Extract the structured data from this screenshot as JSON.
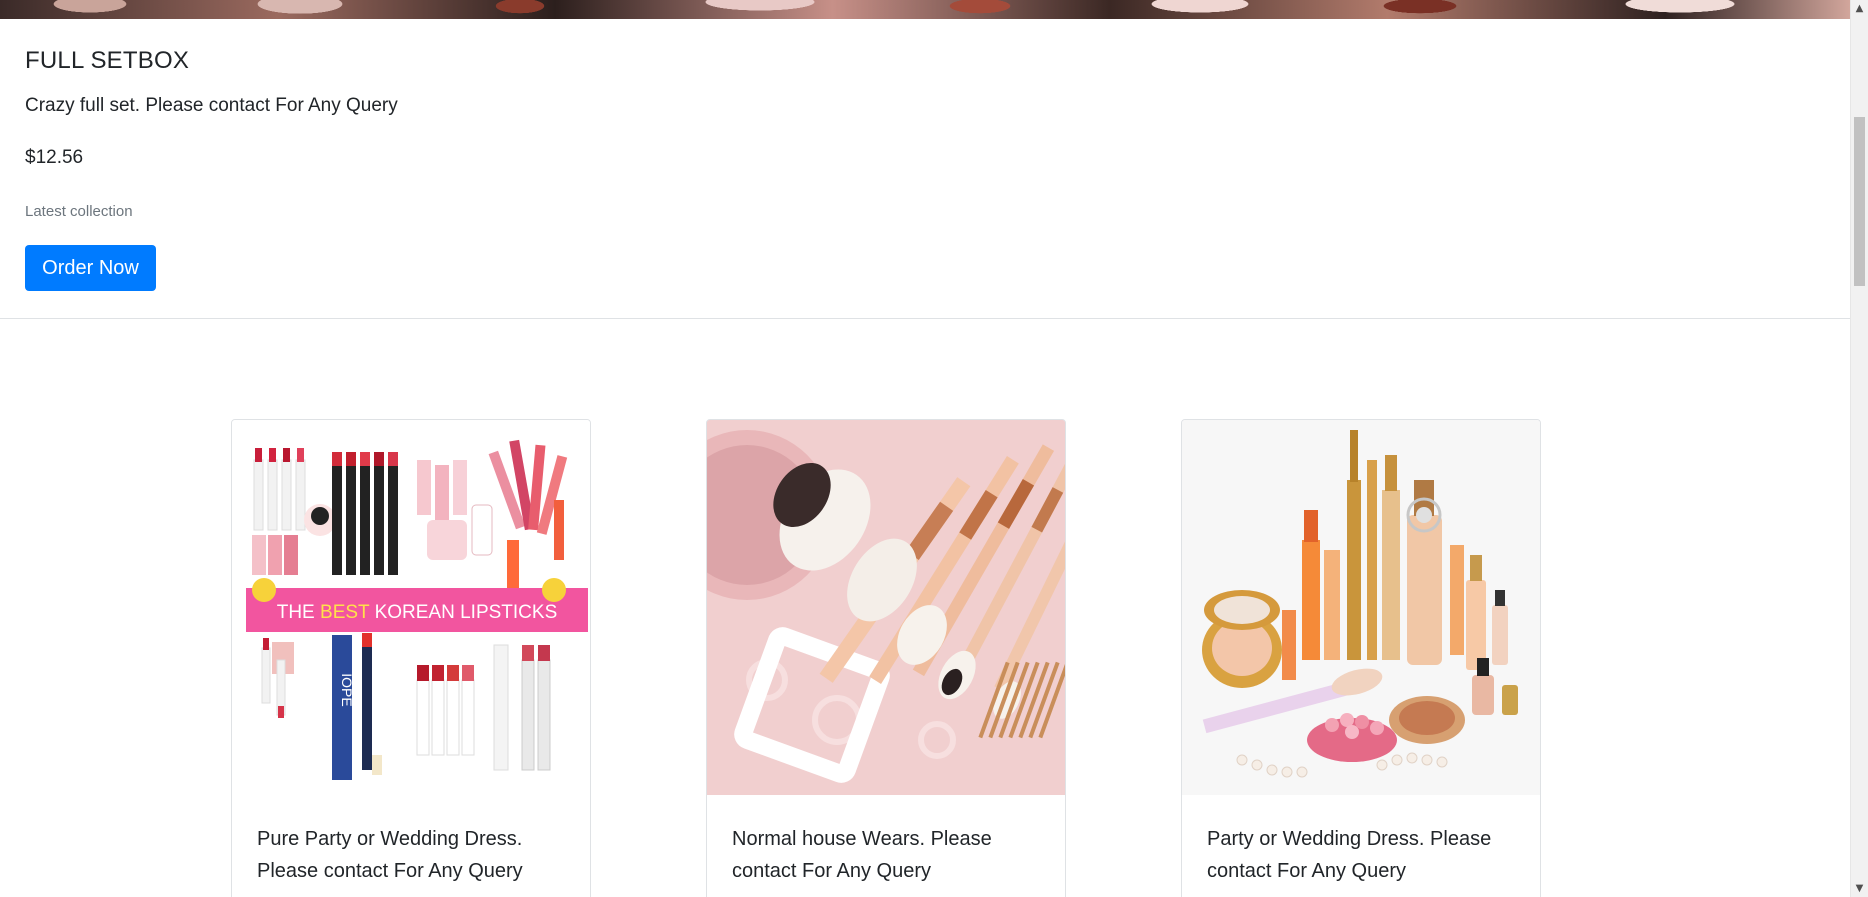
{
  "feature": {
    "title": "FULL SETBOX",
    "description": "Crazy full set. Please contact For Any Query",
    "price": "$12.56",
    "note": "Latest collection",
    "button_label": "Order Now"
  },
  "products": [
    {
      "image_alt": "Korean lipsticks collection",
      "image_banner_text": "THE BEST KOREAN LIPSTICKS",
      "text": "Pure Party or Wedding Dress. Please contact For Any Query"
    },
    {
      "image_alt": "Makeup brushes on pink background",
      "text": "Normal house Wears. Please contact For Any Query"
    },
    {
      "image_alt": "Cosmetics and makeup products set",
      "text": "Party or Wedding Dress. Please contact For Any Query"
    }
  ],
  "scrollbar": {
    "up_icon": "chevron-up-icon",
    "down_icon": "chevron-down-icon"
  }
}
